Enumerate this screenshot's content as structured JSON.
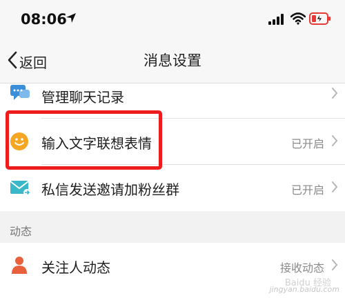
{
  "status_bar": {
    "time": "08:06",
    "icons": [
      "location-arrow-icon",
      "cellular-signal-icon",
      "wifi-icon",
      "battery-charging-icon"
    ],
    "battery_color": "#e53935"
  },
  "nav": {
    "back_label": "返回",
    "title": "消息设置"
  },
  "rows": [
    {
      "label": "管理聊天记录",
      "value": "",
      "icon": "chat-bubble-icon",
      "icon_color": "#3b8fd9"
    },
    {
      "label": "输入文字联想表情",
      "value": "已开启",
      "icon": "smiley-face-icon",
      "icon_color": "#f5a623"
    },
    {
      "label": "私信发送邀请加粉丝群",
      "value": "已开启",
      "icon": "mail-icon",
      "icon_color": "#3bb8c8"
    }
  ],
  "section": {
    "title": "动态"
  },
  "section_rows": [
    {
      "label": "关注人动态",
      "value": "接收动态",
      "icon": "person-icon",
      "icon_color": "#e8603c"
    }
  ],
  "highlight_color": "#ee1c1c",
  "watermark": {
    "logo_text": "Baidu 经验",
    "url": "jingyan.baidu.com"
  }
}
